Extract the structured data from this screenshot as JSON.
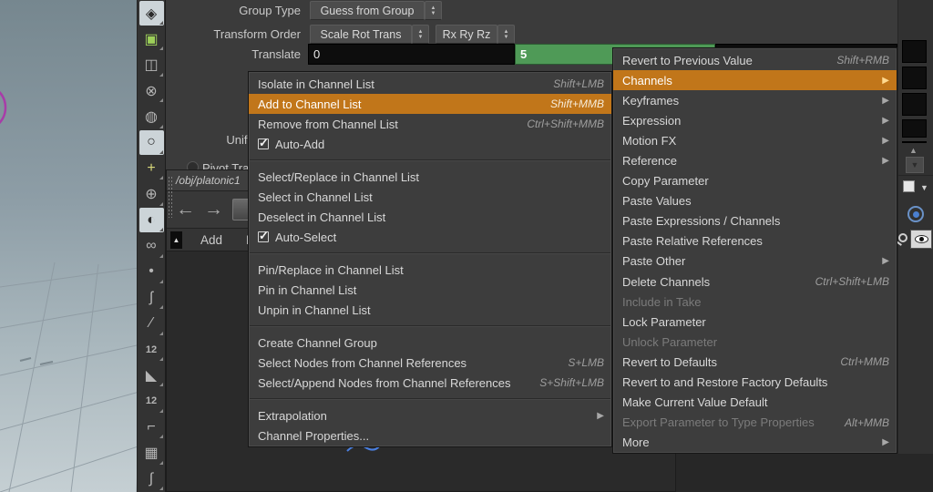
{
  "colors": {
    "highlight_orange": "#c1761a",
    "green_field": "#4f9a57",
    "viewport_purple": "#a83ca8"
  },
  "toolbar": {
    "items": [
      {
        "name": "viewport-layout-icon",
        "glyph": "◈",
        "state": "hl"
      },
      {
        "name": "snap-options-icon",
        "glyph": "▣",
        "color": "#9ccf59"
      },
      {
        "name": "lock-icon",
        "glyph": "◫"
      },
      {
        "name": "lights-off-icon",
        "glyph": "⊗"
      },
      {
        "name": "material-sphere-icon",
        "glyph": "◍"
      },
      {
        "name": "headlight-icon",
        "glyph": "○",
        "state": "hl"
      },
      {
        "name": "add-light-icon",
        "glyph": "+",
        "color": "#d8d87a"
      },
      {
        "name": "pin-light-icon",
        "glyph": "⊕"
      },
      {
        "name": "display-checker-icon",
        "glyph": "◐",
        "state": "hl"
      },
      {
        "name": "shaded-glasses-icon",
        "glyph": "∞"
      },
      {
        "name": "point-marker-icon",
        "glyph": "•"
      },
      {
        "name": "hook-marker-icon",
        "glyph": "ʃ"
      },
      {
        "name": "pen-marker-icon",
        "glyph": "∕"
      },
      {
        "name": "point-numbers-icon",
        "glyph": "12",
        "num": true
      },
      {
        "name": "prim-normals-icon",
        "glyph": "◣"
      },
      {
        "name": "prim-numbers-icon",
        "glyph": "12",
        "num": true
      },
      {
        "name": "profile-curve-icon",
        "glyph": "⌐"
      },
      {
        "name": "handle-region-icon",
        "glyph": "▦"
      },
      {
        "name": "brush-icon",
        "glyph": "∫"
      }
    ]
  },
  "params": {
    "group_type_label": "Group Type",
    "group_type_value": "Guess from Group",
    "transform_order_label": "Transform Order",
    "transform_order_value1": "Scale Rot Trans",
    "transform_order_value2": "Rx Ry Rz",
    "translate_label": "Translate",
    "translate_x": "0",
    "translate_y": "5",
    "uniform_scale_label": "Uniform Scale",
    "pivot_label": "Pivot Transform"
  },
  "panel": {
    "path": "/obj/platonic1",
    "tabs": [
      {
        "label": "Add"
      },
      {
        "label": "Edit"
      }
    ]
  },
  "left_menu": {
    "items": [
      {
        "label": "Isolate in Channel List",
        "shortcut": "Shift+LMB"
      },
      {
        "label": "Add to Channel List",
        "shortcut": "Shift+MMB",
        "state": "highlight"
      },
      {
        "label": "Remove from Channel List",
        "shortcut": "Ctrl+Shift+MMB"
      },
      {
        "label": "Auto-Add",
        "checkbox": true
      },
      {
        "separator": true
      },
      {
        "label": "Select/Replace in Channel List"
      },
      {
        "label": "Select in Channel List"
      },
      {
        "label": "Deselect in Channel List"
      },
      {
        "label": "Auto-Select",
        "checkbox": true
      },
      {
        "separator": true
      },
      {
        "label": "Pin/Replace in Channel List"
      },
      {
        "label": "Pin in Channel List"
      },
      {
        "label": "Unpin in Channel List"
      },
      {
        "separator": true
      },
      {
        "label": "Create Channel Group"
      },
      {
        "label": "Select Nodes from Channel References",
        "shortcut": "S+LMB"
      },
      {
        "label": "Select/Append Nodes from Channel References",
        "shortcut": "S+Shift+LMB"
      },
      {
        "separator": true
      },
      {
        "label": "Extrapolation",
        "arrow": true
      },
      {
        "label": "Channel Properties..."
      }
    ]
  },
  "submenu": {
    "items": [
      {
        "label": "Revert to Previous Value",
        "shortcut": "Shift+RMB"
      },
      {
        "label": "Channels",
        "arrow": true,
        "state": "highlight"
      },
      {
        "label": "Keyframes",
        "arrow": true
      },
      {
        "label": "Expression",
        "arrow": true
      },
      {
        "label": "Motion FX",
        "arrow": true
      },
      {
        "label": "Reference",
        "arrow": true
      },
      {
        "label": "Copy Parameter"
      },
      {
        "label": "Paste Values"
      },
      {
        "label": "Paste Expressions / Channels"
      },
      {
        "label": "Paste Relative References"
      },
      {
        "label": "Paste Other",
        "arrow": true
      },
      {
        "label": "Delete Channels",
        "shortcut": "Ctrl+Shift+LMB"
      },
      {
        "label": "Include in Take",
        "state": "disabled"
      },
      {
        "label": "Lock Parameter"
      },
      {
        "label": "Unlock Parameter",
        "state": "disabled"
      },
      {
        "label": "Revert to Defaults",
        "shortcut": "Ctrl+MMB"
      },
      {
        "label": "Revert to and Restore Factory Defaults"
      },
      {
        "label": "Make Current Value Default"
      },
      {
        "label": "Export Parameter to Type Properties",
        "shortcut": "Alt+MMB",
        "state": "disabled"
      },
      {
        "label": "More",
        "arrow": true
      }
    ]
  },
  "watermark": "ry"
}
